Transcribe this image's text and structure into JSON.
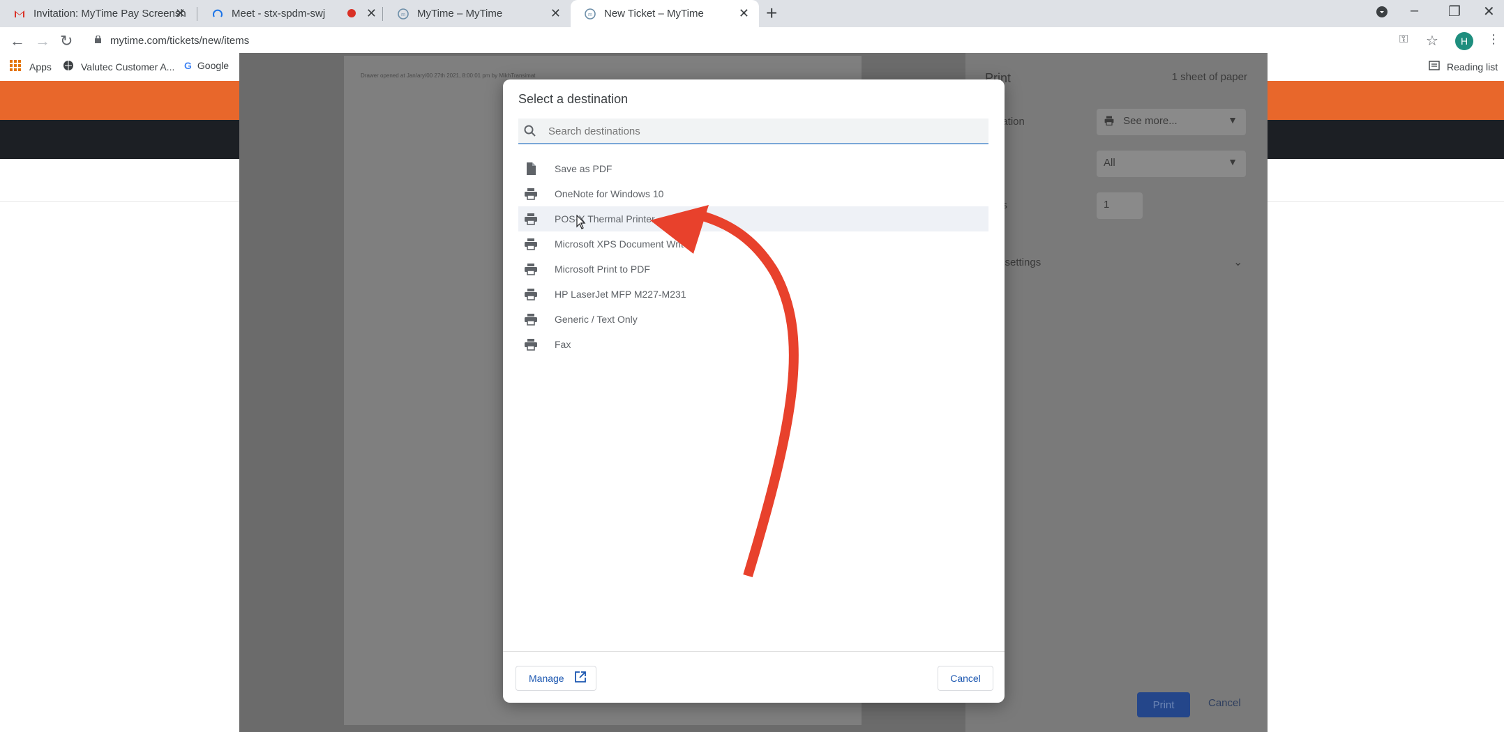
{
  "browser": {
    "tabs": [
      {
        "title": "Invitation: MyTime Pay Screensh",
        "icon": "gmail-icon"
      },
      {
        "title": "Meet - stx-spdm-swj",
        "icon": "meet-loading-icon"
      },
      {
        "title": "MyTime – MyTime",
        "icon": "mytime-icon"
      },
      {
        "title": "New Ticket – MyTime",
        "icon": "mytime-icon",
        "active": true
      }
    ],
    "url": "mytime.com/tickets/new/items",
    "profile_initial": "H",
    "bookmarks": [
      "Apps",
      "Valutec Customer A...",
      "Google"
    ],
    "reading_list": "Reading list"
  },
  "print_preview": {
    "paper_header": "Drawer opened at Jan/ary/00 27th 2021, 8:00:01 pm by MikhTransimat",
    "title": "Print",
    "sheets": "1 sheet of paper",
    "destination_label": "nation",
    "destination_value": "See more...",
    "pages_label": "s",
    "pages_value": "All",
    "copies_label": "es",
    "copies_value": "1",
    "more_settings": "e settings",
    "print_button": "Print",
    "cancel_button": "Cancel"
  },
  "dialog": {
    "title": "Select a destination",
    "search_placeholder": "Search destinations",
    "destinations": [
      {
        "label": "Save as PDF",
        "icon": "document-icon"
      },
      {
        "label": "OneNote for Windows 10",
        "icon": "printer-icon"
      },
      {
        "label": "POS-X Thermal Printer",
        "icon": "printer-icon",
        "highlighted": true
      },
      {
        "label": "Microsoft XPS Document Writer",
        "icon": "printer-icon"
      },
      {
        "label": "Microsoft Print to PDF",
        "icon": "printer-icon"
      },
      {
        "label": "HP LaserJet MFP M227-M231",
        "icon": "printer-icon"
      },
      {
        "label": "Generic / Text Only",
        "icon": "printer-icon"
      },
      {
        "label": "Fax",
        "icon": "printer-icon"
      }
    ],
    "manage_label": "Manage",
    "cancel_label": "Cancel"
  },
  "colors": {
    "annotation_arrow": "#e8412c",
    "orange_header": "#e8672b",
    "dark_header": "#1c1f24",
    "link_blue": "#1a56b0"
  }
}
